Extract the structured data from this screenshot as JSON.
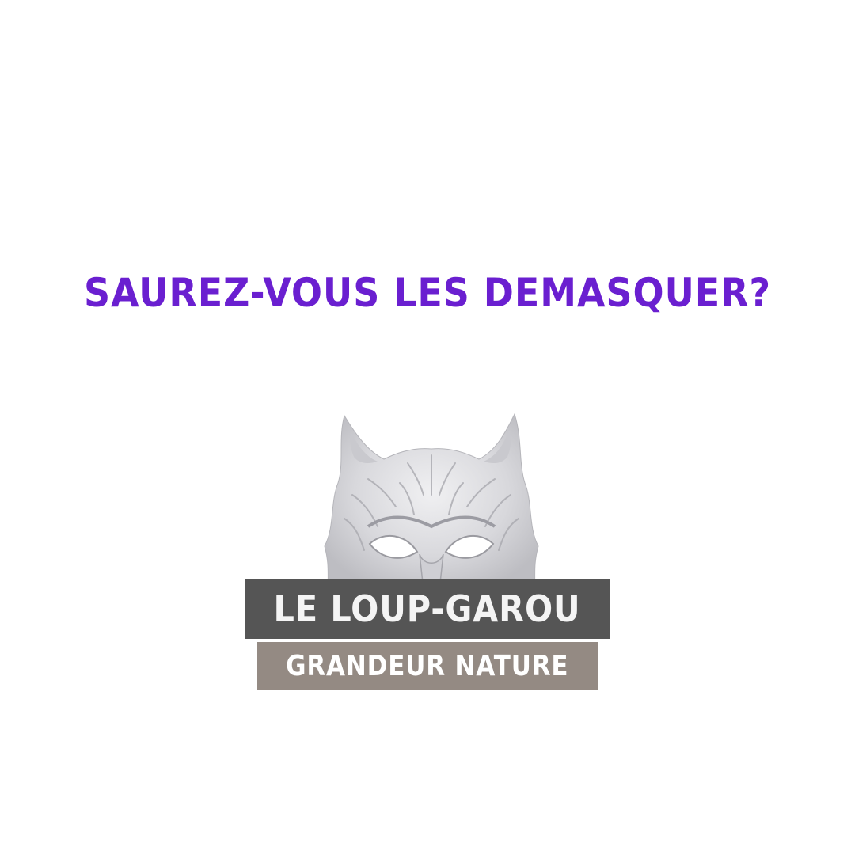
{
  "headline": "SAUREZ-VOUS LES DEMASQUER?",
  "image": {
    "icon": "wolf-mask-image"
  },
  "title": "LE LOUP-GAROU",
  "subtitle": "GRANDEUR NATURE",
  "colors": {
    "background": "#ffffff",
    "headline": "#6a1fd0",
    "title_box": "#555555",
    "subtitle_box": "#948a83",
    "label_text": "#ffffff"
  }
}
